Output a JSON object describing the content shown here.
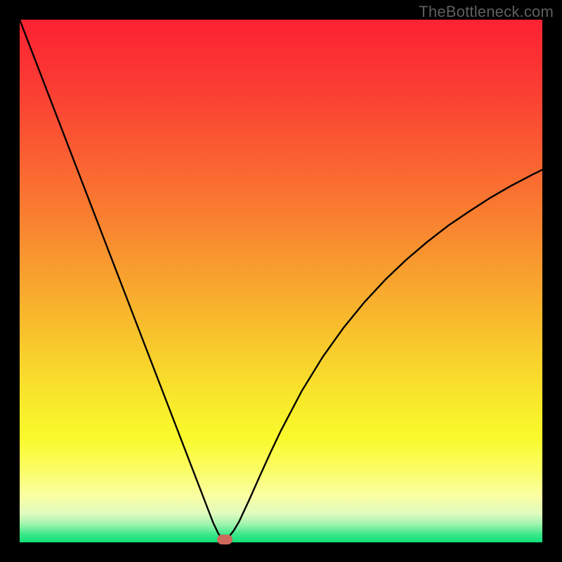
{
  "watermark": "TheBottleneck.com",
  "chart_data": {
    "type": "line",
    "title": "",
    "xlabel": "",
    "ylabel": "",
    "xlim": [
      0,
      100
    ],
    "ylim": [
      0,
      100
    ],
    "grid": false,
    "legend": false,
    "gradient_stops": [
      {
        "offset": 0.0,
        "color": "#fc2233"
      },
      {
        "offset": 0.12,
        "color": "#fb3a33"
      },
      {
        "offset": 0.25,
        "color": "#fa5c32"
      },
      {
        "offset": 0.38,
        "color": "#f98030"
      },
      {
        "offset": 0.5,
        "color": "#f8a42e"
      },
      {
        "offset": 0.62,
        "color": "#f8c82c"
      },
      {
        "offset": 0.72,
        "color": "#f8e62b"
      },
      {
        "offset": 0.8,
        "color": "#f9fa2b"
      },
      {
        "offset": 0.86,
        "color": "#fafd63"
      },
      {
        "offset": 0.91,
        "color": "#fbfea1"
      },
      {
        "offset": 0.945,
        "color": "#e1fbbf"
      },
      {
        "offset": 0.965,
        "color": "#a1f4ae"
      },
      {
        "offset": 0.985,
        "color": "#3be789"
      },
      {
        "offset": 1.0,
        "color": "#0fe179"
      }
    ],
    "series": [
      {
        "name": "bottleneck-curve",
        "stroke": "#000000",
        "x": [
          0,
          2,
          4,
          6,
          8,
          10,
          12,
          14,
          16,
          18,
          20,
          22,
          24,
          26,
          28,
          30,
          32,
          34,
          36,
          37,
          38,
          38.7,
          39.3,
          40,
          41,
          42,
          44,
          46,
          48,
          50,
          54,
          58,
          62,
          66,
          70,
          74,
          78,
          82,
          86,
          90,
          94,
          98,
          100
        ],
        "y": [
          100,
          94.8,
          89.6,
          84.4,
          79.2,
          74.0,
          68.8,
          63.6,
          58.4,
          53.2,
          48.0,
          42.8,
          37.6,
          32.4,
          27.2,
          22.0,
          16.8,
          11.6,
          6.4,
          3.8,
          1.7,
          0.7,
          0.6,
          1.0,
          2.3,
          4.0,
          8.3,
          12.8,
          17.2,
          21.4,
          29.0,
          35.5,
          41.1,
          46.0,
          50.3,
          54.1,
          57.5,
          60.6,
          63.3,
          65.9,
          68.2,
          70.3,
          71.3
        ]
      }
    ],
    "marker": {
      "x": 39.3,
      "y": 0.6,
      "color": "#cd6a5d",
      "shape": "rounded-rect"
    }
  }
}
